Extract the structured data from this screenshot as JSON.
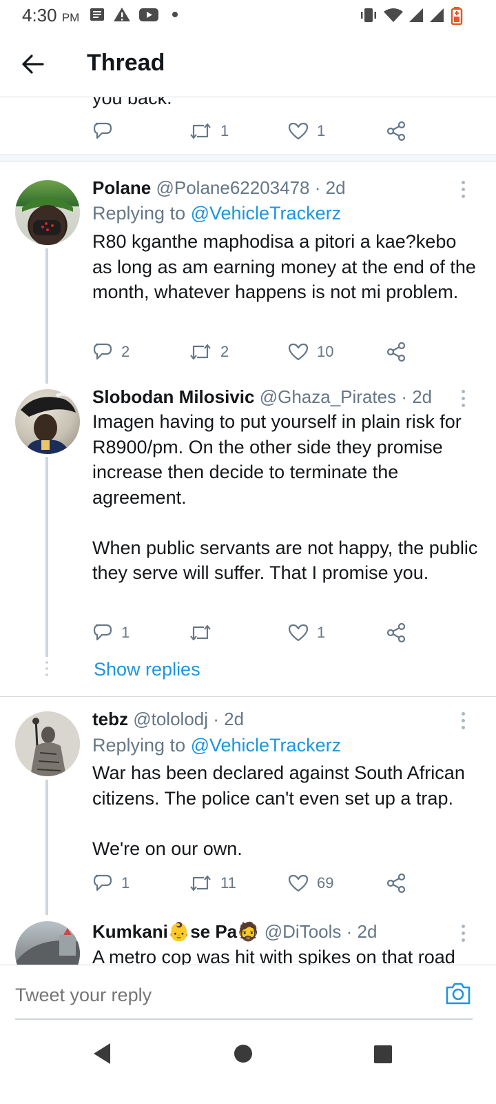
{
  "status_bar": {
    "time": "4:30",
    "ampm": "PM"
  },
  "header": {
    "title": "Thread"
  },
  "partial_tweet": {
    "text_fragment": "you back.",
    "retweets": "1",
    "likes": "1"
  },
  "tweets": [
    {
      "name": "Polane",
      "handle": "@Polane62203478 · 2d",
      "replying_label": "Replying to ",
      "replying_to": "@VehicleTrackerz",
      "text": "R80 kganthe maphodisa a pitori a kae?kebo as long as am earning money at the end of the month, whatever happens is not mi problem.",
      "replies": "2",
      "retweets": "2",
      "likes": "10"
    },
    {
      "name": "Slobodan Milosivic",
      "handle": "@Ghaza_Pirates · 2d",
      "text": "Imagen having to put yourself in plain risk for R8900/pm. On the other side they promise increase then decide to terminate the agreement.\n\nWhen public servants are not happy, the public they serve will suffer. That I promise you.",
      "replies": "1",
      "retweets": "",
      "likes": "1",
      "show_replies": "Show replies"
    },
    {
      "name": "tebz",
      "handle": "@tololodj · 2d",
      "replying_label": "Replying to ",
      "replying_to": "@VehicleTrackerz",
      "text": "War has been declared against South African citizens. The police can't even set up a trap.\n\nWe're on our own.",
      "replies": "1",
      "retweets": "11",
      "likes": "69"
    },
    {
      "name_part1": "Kumkani",
      "name_emoji1": "👶",
      "name_part2": "se Pa",
      "name_emoji2": "🧔",
      "handle": "@DiTools · 2d",
      "text": "A metro cop was hit with spikes on that road"
    }
  ],
  "reply_box": {
    "placeholder": "Tweet your reply"
  },
  "colors": {
    "accent": "#1b95e0",
    "muted": "#657786",
    "text": "#14171a",
    "line": "#ccd6dd"
  }
}
